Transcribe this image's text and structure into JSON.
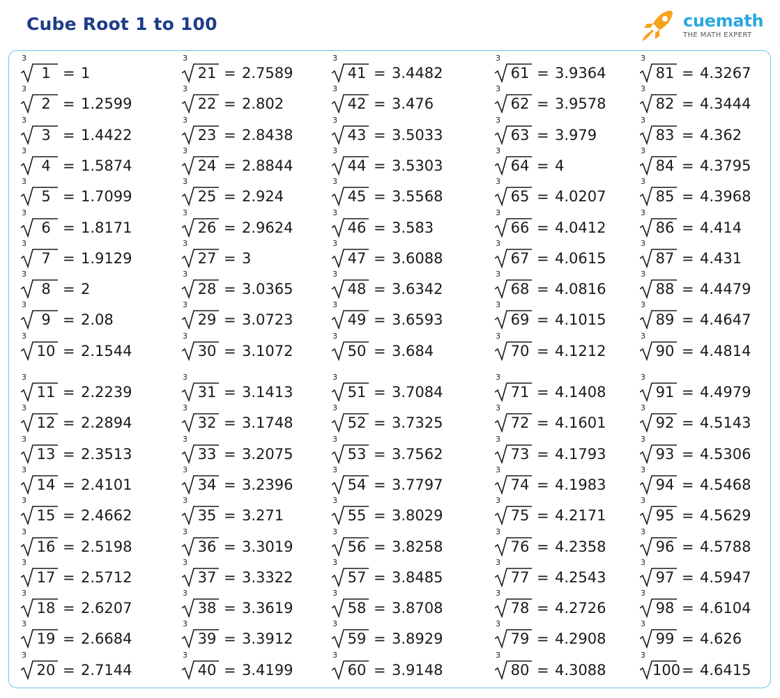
{
  "title": "Cube Root 1 to 100",
  "logo": {
    "name": "cuemath",
    "tagline": "THE MATH EXPERT",
    "icon": "rocket-icon"
  },
  "colors": {
    "title": "#1f3c88",
    "brand": "#2aa7e0",
    "border": "#6ec6ea"
  },
  "root_index": "3",
  "equals": "=",
  "columns": [
    {
      "rows": [
        {
          "n": "1",
          "v": "1"
        },
        {
          "n": "2",
          "v": "1.2599"
        },
        {
          "n": "3",
          "v": "1.4422"
        },
        {
          "n": "4",
          "v": "1.5874"
        },
        {
          "n": "5",
          "v": "1.7099"
        },
        {
          "n": "6",
          "v": "1.8171"
        },
        {
          "n": "7",
          "v": "1.9129"
        },
        {
          "n": "8",
          "v": "2"
        },
        {
          "n": "9",
          "v": "2.08"
        },
        {
          "n": "10",
          "v": "2.1544"
        },
        {
          "n": "11",
          "v": "2.2239"
        },
        {
          "n": "12",
          "v": "2.2894"
        },
        {
          "n": "13",
          "v": "2.3513"
        },
        {
          "n": "14",
          "v": "2.4101"
        },
        {
          "n": "15",
          "v": "2.4662"
        },
        {
          "n": "16",
          "v": "2.5198"
        },
        {
          "n": "17",
          "v": "2.5712"
        },
        {
          "n": "18",
          "v": "2.6207"
        },
        {
          "n": "19",
          "v": "2.6684"
        },
        {
          "n": "20",
          "v": "2.7144"
        }
      ]
    },
    {
      "rows": [
        {
          "n": "21",
          "v": "2.7589"
        },
        {
          "n": "22",
          "v": "2.802"
        },
        {
          "n": "23",
          "v": "2.8438"
        },
        {
          "n": "24",
          "v": "2.8844"
        },
        {
          "n": "25",
          "v": "2.924"
        },
        {
          "n": "26",
          "v": "2.9624"
        },
        {
          "n": "27",
          "v": "3"
        },
        {
          "n": "28",
          "v": "3.0365"
        },
        {
          "n": "29",
          "v": "3.0723"
        },
        {
          "n": "30",
          "v": "3.1072"
        },
        {
          "n": "31",
          "v": "3.1413"
        },
        {
          "n": "32",
          "v": "3.1748"
        },
        {
          "n": "33",
          "v": "3.2075"
        },
        {
          "n": "34",
          "v": "3.2396"
        },
        {
          "n": "35",
          "v": "3.271"
        },
        {
          "n": "36",
          "v": "3.3019"
        },
        {
          "n": "37",
          "v": "3.3322"
        },
        {
          "n": "38",
          "v": "3.3619"
        },
        {
          "n": "39",
          "v": "3.3912"
        },
        {
          "n": "40",
          "v": "3.4199"
        }
      ]
    },
    {
      "rows": [
        {
          "n": "41",
          "v": "3.4482"
        },
        {
          "n": "42",
          "v": "3.476"
        },
        {
          "n": "43",
          "v": "3.5033"
        },
        {
          "n": "44",
          "v": "3.5303"
        },
        {
          "n": "45",
          "v": "3.5568"
        },
        {
          "n": "46",
          "v": "3.583"
        },
        {
          "n": "47",
          "v": "3.6088"
        },
        {
          "n": "48",
          "v": "3.6342"
        },
        {
          "n": "49",
          "v": "3.6593"
        },
        {
          "n": "50",
          "v": "3.684"
        },
        {
          "n": "51",
          "v": "3.7084"
        },
        {
          "n": "52",
          "v": "3.7325"
        },
        {
          "n": "53",
          "v": "3.7562"
        },
        {
          "n": "54",
          "v": "3.7797"
        },
        {
          "n": "55",
          "v": "3.8029"
        },
        {
          "n": "56",
          "v": "3.8258"
        },
        {
          "n": "57",
          "v": "3.8485"
        },
        {
          "n": "58",
          "v": "3.8708"
        },
        {
          "n": "59",
          "v": "3.8929"
        },
        {
          "n": "60",
          "v": "3.9148"
        }
      ]
    },
    {
      "rows": [
        {
          "n": "61",
          "v": "3.9364"
        },
        {
          "n": "62",
          "v": "3.9578"
        },
        {
          "n": "63",
          "v": "3.979"
        },
        {
          "n": "64",
          "v": "4"
        },
        {
          "n": "65",
          "v": "4.0207"
        },
        {
          "n": "66",
          "v": "4.0412"
        },
        {
          "n": "67",
          "v": "4.0615"
        },
        {
          "n": "68",
          "v": "4.0816"
        },
        {
          "n": "69",
          "v": "4.1015"
        },
        {
          "n": "70",
          "v": "4.1212"
        },
        {
          "n": "71",
          "v": "4.1408"
        },
        {
          "n": "72",
          "v": "4.1601"
        },
        {
          "n": "73",
          "v": "4.1793"
        },
        {
          "n": "74",
          "v": "4.1983"
        },
        {
          "n": "75",
          "v": "4.2171"
        },
        {
          "n": "76",
          "v": "4.2358"
        },
        {
          "n": "77",
          "v": "4.2543"
        },
        {
          "n": "78",
          "v": "4.2726"
        },
        {
          "n": "79",
          "v": "4.2908"
        },
        {
          "n": "80",
          "v": "4.3088"
        }
      ]
    },
    {
      "rows": [
        {
          "n": "81",
          "v": "4.3267"
        },
        {
          "n": "82",
          "v": "4.3444"
        },
        {
          "n": "83",
          "v": "4.362"
        },
        {
          "n": "84",
          "v": "4.3795"
        },
        {
          "n": "85",
          "v": "4.3968"
        },
        {
          "n": "86",
          "v": "4.414"
        },
        {
          "n": "87",
          "v": "4.431"
        },
        {
          "n": "88",
          "v": "4.4479"
        },
        {
          "n": "89",
          "v": "4.4647"
        },
        {
          "n": "90",
          "v": "4.4814"
        },
        {
          "n": "91",
          "v": "4.4979"
        },
        {
          "n": "92",
          "v": "4.5143"
        },
        {
          "n": "93",
          "v": "4.5306"
        },
        {
          "n": "94",
          "v": "4.5468"
        },
        {
          "n": "95",
          "v": "4.5629"
        },
        {
          "n": "96",
          "v": "4.5788"
        },
        {
          "n": "97",
          "v": "4.5947"
        },
        {
          "n": "98",
          "v": "4.6104"
        },
        {
          "n": "99",
          "v": "4.626"
        },
        {
          "n": "100",
          "v": "4.6415"
        }
      ]
    }
  ]
}
